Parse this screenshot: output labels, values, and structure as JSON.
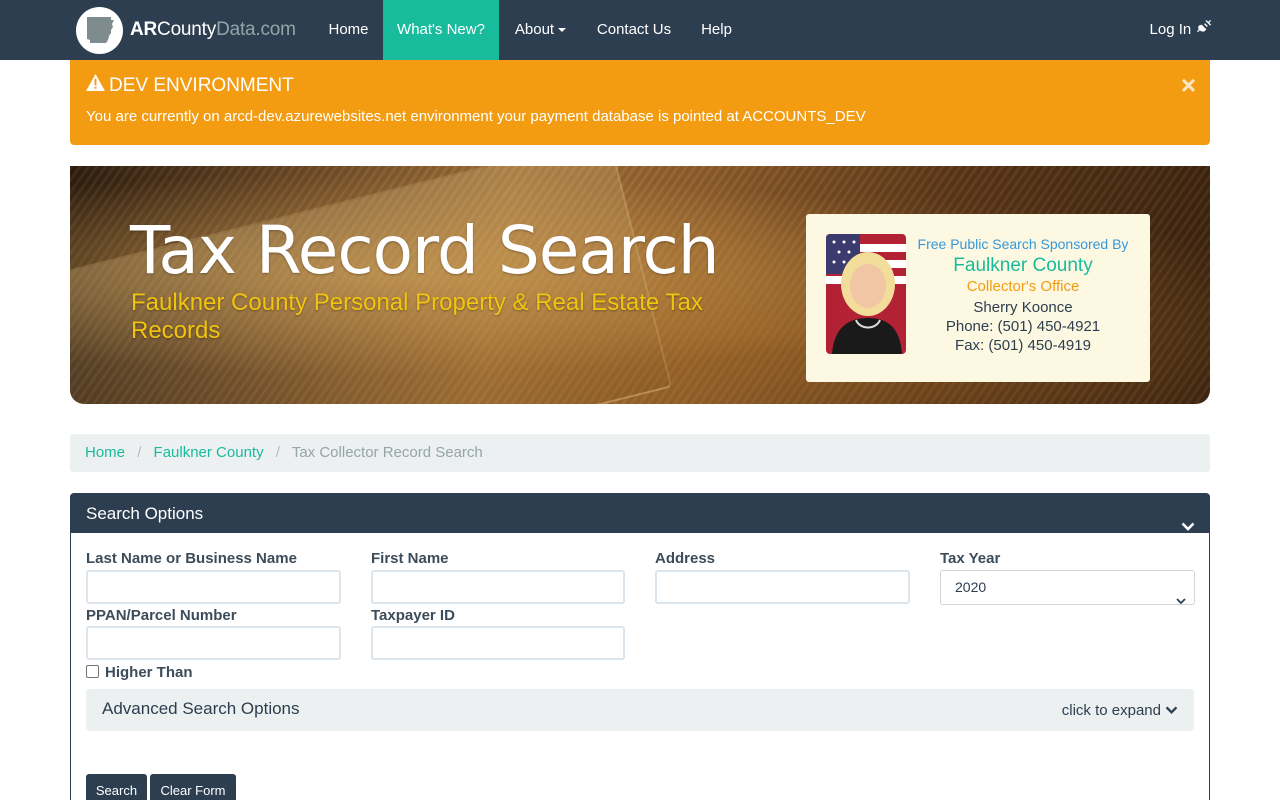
{
  "navbar": {
    "brand_ar": "AR",
    "brand_county": "County",
    "brand_data": "Data.com",
    "items": [
      {
        "label": "Home"
      },
      {
        "label": "What's New?"
      },
      {
        "label": "About"
      },
      {
        "label": "Contact Us"
      },
      {
        "label": "Help"
      }
    ],
    "login_label": "Log In",
    "active_color": "#18bc9c",
    "bg_color": "#2c3e50"
  },
  "alert": {
    "title": "DEV ENVIRONMENT",
    "message": "You are currently on arcd-dev.azurewebsites.net environment your payment database is pointed at ACCOUNTS_DEV",
    "close_symbol": "×",
    "color": "#f39c12"
  },
  "hero": {
    "title": "Tax Record Search",
    "subtitle": "Faulkner County Personal Property & Real Estate Tax Records",
    "sponsor": {
      "line1": "Free Public Search Sponsored By",
      "county": "Faulkner County",
      "office": "Collector's Office",
      "name": "Sherry Koonce",
      "phone": "Phone: (501) 450-4921",
      "fax": "Fax: (501) 450-4919"
    }
  },
  "breadcrumb": {
    "items": [
      {
        "label": "Home"
      },
      {
        "label": "Faulkner County"
      }
    ],
    "current": "Tax Collector Record Search",
    "separator": "/"
  },
  "search_panel": {
    "title": "Search Options",
    "fields": {
      "last_name": {
        "label": "Last Name or Business Name",
        "value": ""
      },
      "first_name": {
        "label": "First Name",
        "value": ""
      },
      "address": {
        "label": "Address",
        "value": ""
      },
      "tax_year": {
        "label": "Tax Year",
        "selected": "2020"
      },
      "parcel": {
        "label": "PPAN/Parcel Number",
        "value": ""
      },
      "taxpayer_id": {
        "label": "Taxpayer ID",
        "value": ""
      }
    },
    "higher_than_label": "Higher Than",
    "higher_than_checked": false,
    "advanced": {
      "title": "Advanced Search Options",
      "expand_label": "click to expand"
    },
    "buttons": {
      "search": "Search",
      "clear": "Clear Form"
    }
  }
}
